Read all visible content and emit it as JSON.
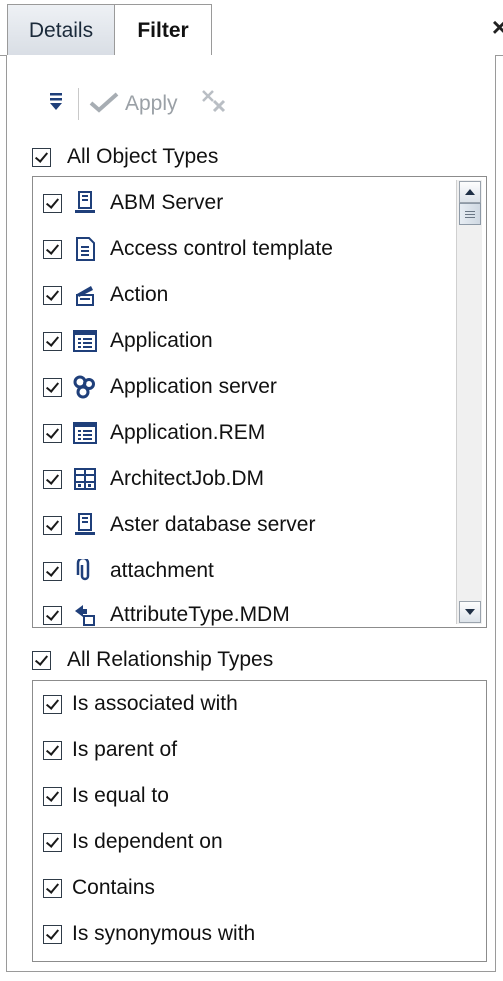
{
  "tabs": {
    "details": "Details",
    "filter": "Filter",
    "close": "×"
  },
  "toolbar": {
    "apply_label": "Apply"
  },
  "object_types": {
    "header_label": "All Object Types",
    "items": [
      {
        "label": "ABM Server",
        "icon": "server-icon"
      },
      {
        "label": "Access control template",
        "icon": "template-icon"
      },
      {
        "label": "Action",
        "icon": "action-icon"
      },
      {
        "label": "Application",
        "icon": "application-icon"
      },
      {
        "label": "Application server",
        "icon": "application-server-icon"
      },
      {
        "label": "Application.REM",
        "icon": "application-icon"
      },
      {
        "label": "ArchitectJob.DM",
        "icon": "job-icon"
      },
      {
        "label": "Aster database server",
        "icon": "server-icon"
      },
      {
        "label": "attachment",
        "icon": "paperclip-icon"
      },
      {
        "label": "AttributeType.MDM",
        "icon": "attribute-type-icon"
      }
    ]
  },
  "relationship_types": {
    "header_label": "All Relationship Types",
    "items": [
      {
        "label": "Is associated with"
      },
      {
        "label": "Is parent of"
      },
      {
        "label": "Is equal to"
      },
      {
        "label": "Is dependent on"
      },
      {
        "label": "Contains"
      },
      {
        "label": "Is synonymous with"
      }
    ]
  },
  "colors": {
    "icon_blue": "#1f3f7a",
    "frame_gray": "#9a9a9a",
    "disabled_text": "#9aa0a6"
  }
}
